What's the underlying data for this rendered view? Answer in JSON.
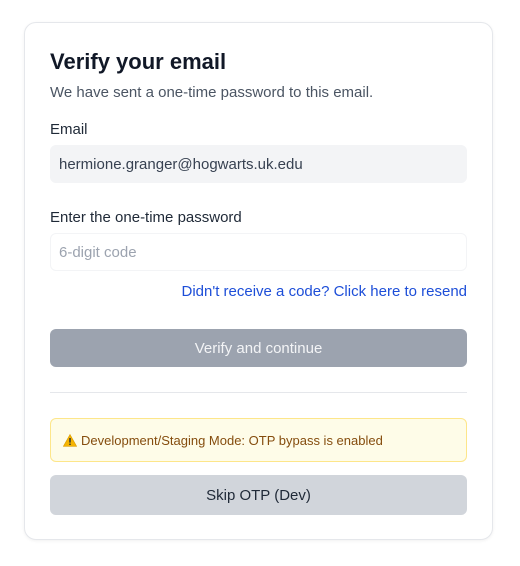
{
  "header": {
    "title": "Verify your email",
    "subtitle": "We have sent a one-time password to this email."
  },
  "email": {
    "label": "Email",
    "value": "hermione.granger@hogwarts.uk.edu"
  },
  "otp": {
    "label": "Enter the one-time password",
    "placeholder": "6-digit code",
    "value": ""
  },
  "resend": {
    "label": "Didn't receive a code? Click here to resend"
  },
  "verify": {
    "label": "Verify and continue",
    "disabled": true
  },
  "dev_banner": {
    "icon": "warning-icon",
    "text": "Development/Staging Mode: OTP bypass is enabled"
  },
  "skip": {
    "label": "Skip OTP (Dev)"
  },
  "colors": {
    "link": "#1d4ed8",
    "verify_disabled_bg": "#9ca3af",
    "banner_bg": "#fefce8",
    "banner_border": "#fde68a",
    "banner_text": "#854d0e",
    "skip_bg": "#d1d5db"
  }
}
